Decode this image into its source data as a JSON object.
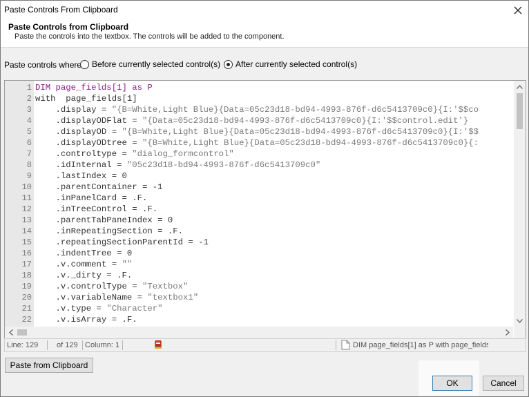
{
  "window": {
    "title": "Paste Controls From Clipboard"
  },
  "header": {
    "title": "Paste Controls from Clipboard",
    "subtitle": "Paste the controls into the textbox. The controls will be added to the component."
  },
  "paste_options": {
    "label": "Paste controls where:",
    "before_label": "Before currently selected control(s)",
    "after_label": "After currently selected control(s)",
    "selected": "after"
  },
  "editor": {
    "lines": [
      {
        "num": "1",
        "parts": [
          [
            "kw",
            "DIM page_fields[1] as P"
          ]
        ]
      },
      {
        "num": "2",
        "parts": [
          [
            "plain",
            "with  page_fields[1]"
          ]
        ]
      },
      {
        "num": "3",
        "parts": [
          [
            "plain",
            "    .display = "
          ],
          [
            "str",
            "\"{B=White,Light Blue}{Data=05c23d18-bd94-4993-876f-d6c5413709c0}{I:'$$co"
          ]
        ]
      },
      {
        "num": "4",
        "parts": [
          [
            "plain",
            "    .displayODFlat = "
          ],
          [
            "str",
            "\"{Data=05c23d18-bd94-4993-876f-d6c5413709c0}{I:'$$control.edit'}"
          ]
        ]
      },
      {
        "num": "5",
        "parts": [
          [
            "plain",
            "    .displayOD = "
          ],
          [
            "str",
            "\"{B=White,Light Blue}{Data=05c23d18-bd94-4993-876f-d6c5413709c0}{I:'$$"
          ]
        ]
      },
      {
        "num": "6",
        "parts": [
          [
            "plain",
            "    .displayODtree = "
          ],
          [
            "str",
            "\"{B=White,Light Blue}{Data=05c23d18-bd94-4993-876f-d6c5413709c0}{:"
          ]
        ]
      },
      {
        "num": "7",
        "parts": [
          [
            "plain",
            "    .controltype = "
          ],
          [
            "str",
            "\"dialog_formcontrol\""
          ]
        ]
      },
      {
        "num": "8",
        "parts": [
          [
            "plain",
            "    .idInternal = "
          ],
          [
            "str",
            "\"05c23d18-bd94-4993-876f-d6c5413709c0\""
          ]
        ]
      },
      {
        "num": "9",
        "parts": [
          [
            "plain",
            "    .lastIndex = 0"
          ]
        ]
      },
      {
        "num": "10",
        "parts": [
          [
            "plain",
            "    .parentContainer = -1"
          ]
        ]
      },
      {
        "num": "11",
        "parts": [
          [
            "plain",
            "    .inPanelCard = .F."
          ]
        ]
      },
      {
        "num": "12",
        "parts": [
          [
            "plain",
            "    .inTreeControl = .F."
          ]
        ]
      },
      {
        "num": "13",
        "parts": [
          [
            "plain",
            "    .parentTabPaneIndex = 0"
          ]
        ]
      },
      {
        "num": "14",
        "parts": [
          [
            "plain",
            "    .inRepeatingSection = .F."
          ]
        ]
      },
      {
        "num": "15",
        "parts": [
          [
            "plain",
            "    .repeatingSectionParentId = -1"
          ]
        ]
      },
      {
        "num": "16",
        "parts": [
          [
            "plain",
            "    .indentTree = 0"
          ]
        ]
      },
      {
        "num": "17",
        "parts": [
          [
            "plain",
            "    .v.comment = "
          ],
          [
            "str",
            "\"\""
          ]
        ]
      },
      {
        "num": "18",
        "parts": [
          [
            "plain",
            "    .v._dirty = .F."
          ]
        ]
      },
      {
        "num": "19",
        "parts": [
          [
            "plain",
            "    .v.controlType = "
          ],
          [
            "str",
            "\"Textbox\""
          ]
        ]
      },
      {
        "num": "20",
        "parts": [
          [
            "plain",
            "    .v.variableName = "
          ],
          [
            "str",
            "\"textbox1\""
          ]
        ]
      },
      {
        "num": "21",
        "parts": [
          [
            "plain",
            "    .v.type = "
          ],
          [
            "str",
            "\"Character\""
          ]
        ]
      },
      {
        "num": "22",
        "parts": [
          [
            "plain",
            "    .v.isArray = .F."
          ]
        ]
      }
    ]
  },
  "status": {
    "line": "Line: 129",
    "of": "of 129",
    "column": "Column: 1",
    "preview": "DIM page_fields[1] as P with page_fields"
  },
  "buttons": {
    "paste_clipboard": "Paste from Clipboard",
    "ok": "OK",
    "cancel": "Cancel"
  },
  "colors": {
    "keyword": "#8b1d8b",
    "string": "#7a7a7a",
    "plain": "#333333"
  }
}
